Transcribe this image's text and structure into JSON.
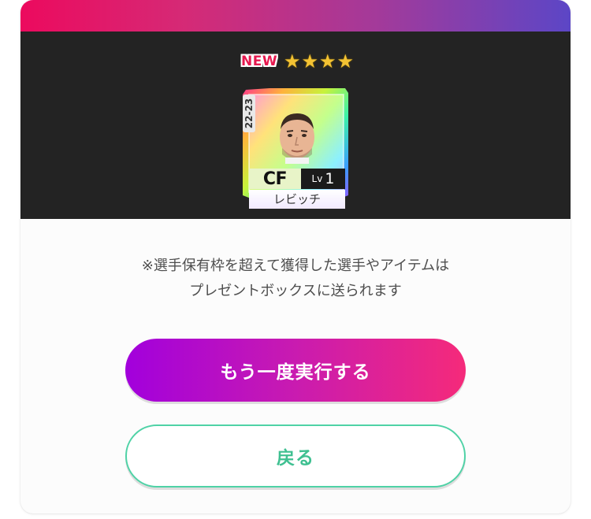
{
  "card": {
    "badge": "NEW",
    "stars": 4,
    "season": "22-23",
    "position": "CF",
    "level_label": "Lv",
    "level_value": "1",
    "player_name": "レビッチ"
  },
  "notice": {
    "line1": "※選手保有枠を超えて獲得した選手やアイテムは",
    "line2": "プレゼントボックスに送られます"
  },
  "buttons": {
    "retry_label": "もう一度実行する",
    "back_label": "戻る"
  },
  "colors": {
    "primary_start": "#a200dc",
    "primary_end": "#f52a7a",
    "secondary_border": "#4fd2a6",
    "header_start": "#ec0a5e",
    "header_end": "#5c46c6"
  }
}
